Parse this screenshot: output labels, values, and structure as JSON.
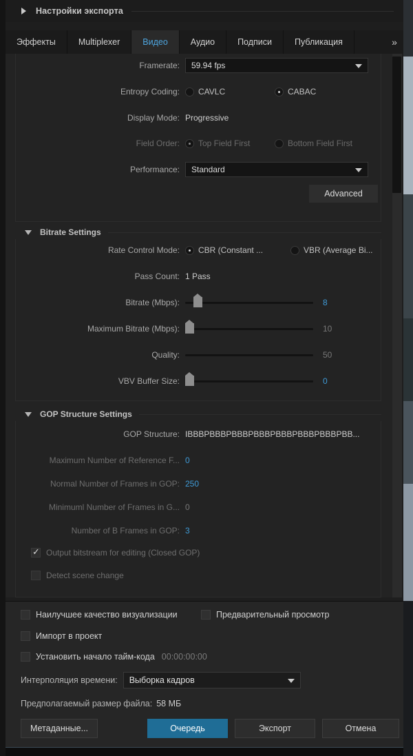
{
  "header": {
    "title": "Настройки экспорта",
    "disclosure_icon": "triangle-right-icon"
  },
  "tabs": {
    "items": [
      {
        "label": "Эффекты",
        "active": false
      },
      {
        "label": "Multiplexer",
        "active": false
      },
      {
        "label": "Видео",
        "active": true
      },
      {
        "label": "Аудио",
        "active": false
      },
      {
        "label": "Подписи",
        "active": false
      },
      {
        "label": "Публикация",
        "active": false
      }
    ],
    "overflow_label": "»"
  },
  "colors": {
    "accent_blue": "#3f9ad6",
    "tab_active_text": "#4ea6e0",
    "primary_button": "#1f6d96",
    "panel_bg": "#232323",
    "bottom_bg": "#262626"
  },
  "basic": {
    "framerate": {
      "label": "Framerate:",
      "value": "59.94 fps",
      "arrow_icon": "chevron-down-icon"
    },
    "entropy": {
      "label": "Entropy Coding:",
      "options": [
        {
          "label": "CAVLC",
          "selected": false
        },
        {
          "label": "CABAC",
          "selected": true
        }
      ]
    },
    "display_mode": {
      "label": "Display Mode:",
      "value": "Progressive"
    },
    "field_order": {
      "label": "Field Order:",
      "disabled": true,
      "options": [
        {
          "label": "Top Field First",
          "selected": true
        },
        {
          "label": "Bottom Field First",
          "selected": false
        }
      ]
    },
    "performance": {
      "label": "Performance:",
      "value": "Standard",
      "arrow_icon": "chevron-down-icon"
    },
    "advanced_button": "Advanced"
  },
  "bitrate": {
    "title": "Bitrate Settings",
    "rate_control": {
      "label": "Rate Control Mode:",
      "options": [
        {
          "label": "CBR (Constant ...",
          "selected": true
        },
        {
          "label": "VBR (Average Bi...",
          "selected": false
        }
      ]
    },
    "pass_count": {
      "label": "Pass Count:",
      "value": "1 Pass"
    },
    "sliders": [
      {
        "label": "Bitrate (Mbps):",
        "value": "8",
        "pct": 6,
        "has_thumb": true,
        "accent": true
      },
      {
        "label": "Maximum Bitrate (Mbps):",
        "value": "10",
        "pct": 0,
        "has_thumb": true,
        "accent": false
      },
      {
        "label": "Quality:",
        "value": "50",
        "pct": 0,
        "has_thumb": false,
        "accent": false
      },
      {
        "label": "VBV Buffer Size:",
        "value": "0",
        "pct": 0,
        "has_thumb": true,
        "accent": true
      }
    ]
  },
  "gop": {
    "title": "GOP Structure Settings",
    "structure": {
      "label": "GOP Structure:",
      "value": "IBBBPBBBPBBBPBBBPBBBPBBBPBBBPBB..."
    },
    "rows": [
      {
        "label": "Maximum Number of Reference F...",
        "value": "0",
        "accent": true,
        "dim": true
      },
      {
        "label": "Normal Number of Frames in GOP:",
        "value": "250",
        "accent": true,
        "dim": true
      },
      {
        "label": "Minimuml Number of Frames in G...",
        "value": "0",
        "accent": false,
        "dim": true
      },
      {
        "label": "Number of B Frames in GOP:",
        "value": "3",
        "accent": true,
        "dim": true
      }
    ],
    "checkboxes": [
      {
        "label": "Output bitstream for editing (Closed GOP)",
        "checked": true
      },
      {
        "label": "Detect scene change",
        "checked": false
      }
    ]
  },
  "bottom": {
    "checkboxes": [
      {
        "label": "Наилучшее качество визуализации",
        "checked": false
      },
      {
        "label": "Предварительный просмотр",
        "checked": false
      },
      {
        "label": "Импорт в проект",
        "checked": false
      },
      {
        "label": "Установить начало тайм-кода",
        "checked": false
      }
    ],
    "timecode": "00:00:00:00",
    "interpolation": {
      "label": "Интерполяция времени:",
      "value": "Выборка кадров",
      "arrow_icon": "chevron-down-icon"
    },
    "filesize": {
      "label": "Предполагаемый размер файла:",
      "value": "58 МБ"
    },
    "buttons": [
      {
        "label": "Метаданные...",
        "primary": false
      },
      {
        "label": "Очередь",
        "primary": true
      },
      {
        "label": "Экспорт",
        "primary": false
      },
      {
        "label": "Отмена",
        "primary": false
      }
    ]
  }
}
